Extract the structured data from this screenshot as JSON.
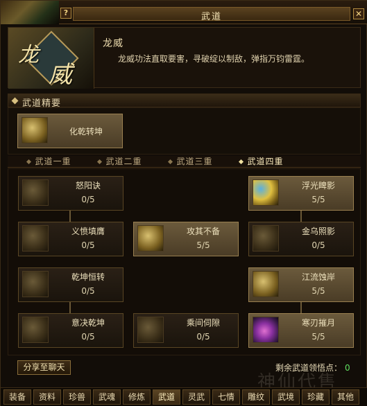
{
  "window": {
    "title": "武道"
  },
  "header": {
    "emblem_text_1": "龙",
    "emblem_text_2": "威",
    "skill_name": "龙威",
    "description": "龙威功法直取要害，寻破绽以制敌，弹指万钧雷霆。"
  },
  "section": {
    "label": "武道精要"
  },
  "essence": {
    "name": "化乾转坤"
  },
  "tabs": [
    "武道一重",
    "武道二重",
    "武道三重",
    "武道四重"
  ],
  "active_tab": "武道四重",
  "skills": [
    {
      "name": "怒阳诀",
      "count": "0/5",
      "icon": "dim"
    },
    {
      "name": "浮光睥影",
      "count": "5/5",
      "icon": "blue"
    },
    {
      "name": "义愤填膺",
      "count": "0/5",
      "icon": "dim"
    },
    {
      "name": "攻其不备",
      "count": "5/5",
      "icon": "gold"
    },
    {
      "name": "金乌照影",
      "count": "0/5",
      "icon": "dim"
    },
    {
      "name": "乾坤恒转",
      "count": "0/5",
      "icon": "dim"
    },
    {
      "name": "江流蚀岸",
      "count": "5/5",
      "icon": "gold"
    },
    {
      "name": "意决乾坤",
      "count": "0/5",
      "icon": "dim"
    },
    {
      "name": "乘间伺隙",
      "count": "0/5",
      "icon": "dim"
    },
    {
      "name": "寒刃摧月",
      "count": "5/5",
      "icon": "violet"
    }
  ],
  "footer": {
    "share_label": "分享至聊天",
    "remaining_label": "剩余武道领悟点：",
    "remaining_value": "0"
  },
  "bottom_tabs": [
    "装备",
    "资料",
    "珍兽",
    "武魂",
    "修炼",
    "武道",
    "灵武",
    "七情",
    "雕纹",
    "武境",
    "珍藏",
    "其他"
  ],
  "active_bottom_tab": "武道",
  "watermark": "神仙代售"
}
